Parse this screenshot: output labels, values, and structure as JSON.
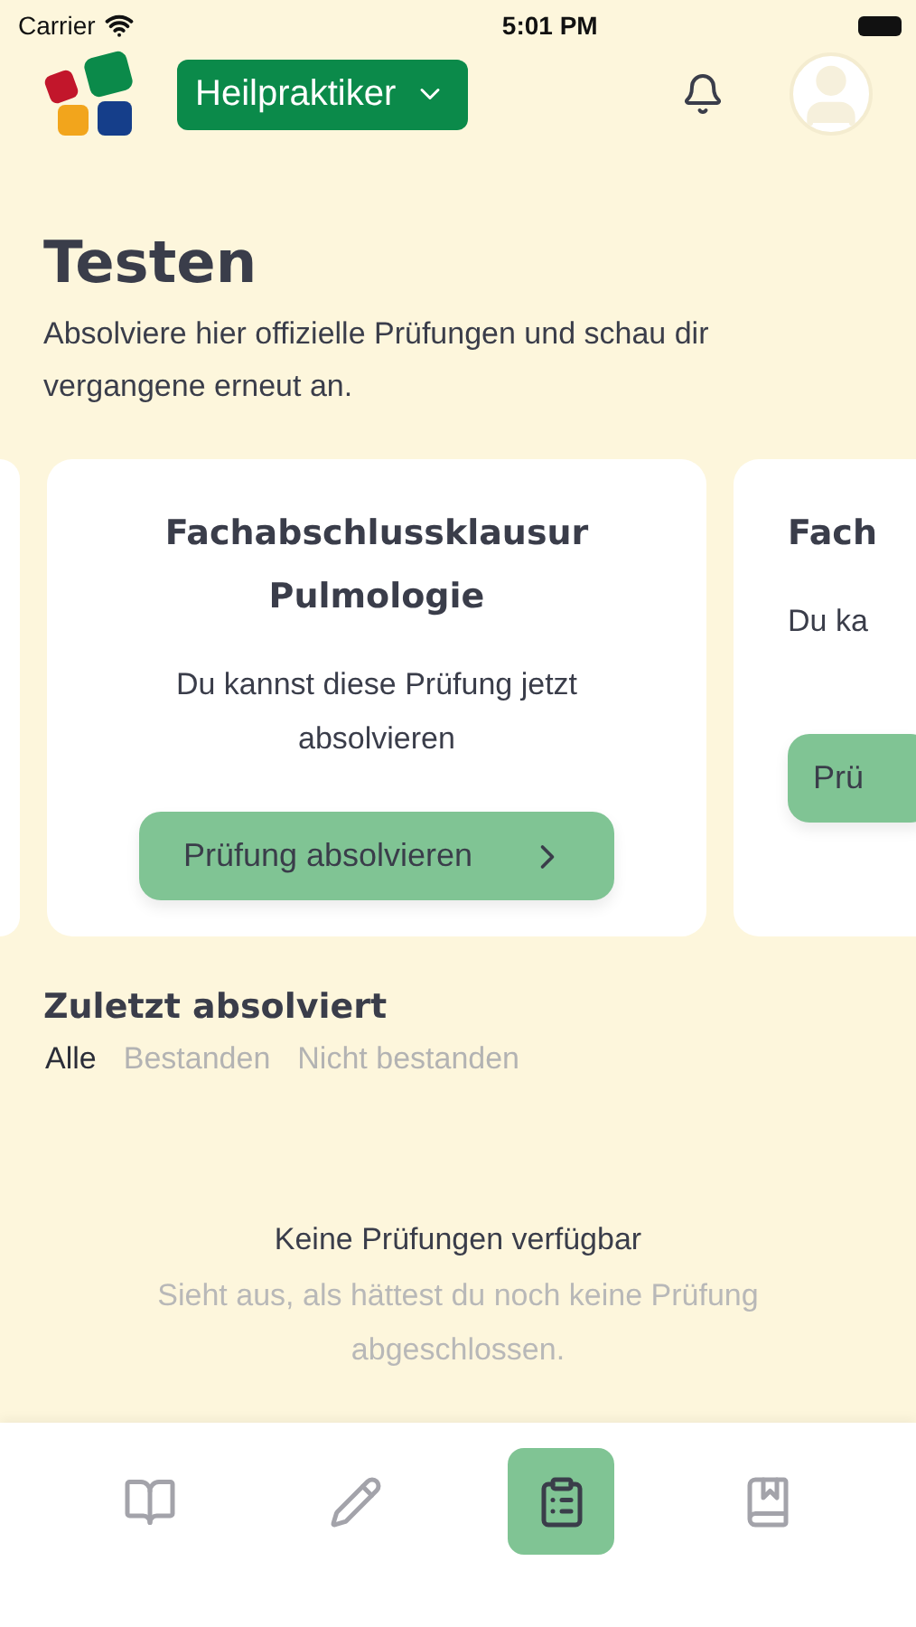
{
  "status_bar": {
    "carrier": "Carrier",
    "time": "5:01 PM"
  },
  "header": {
    "course": "Heilpraktiker"
  },
  "page": {
    "title": "Testen",
    "subtitle": "Absolviere hier offizielle Prüfungen und schau dir vergangene erneut an."
  },
  "exam_cards": [
    {
      "kind": "sliver"
    },
    {
      "kind": "full",
      "title": "Fachabschlussklausur Pulmologie",
      "description": "Du kannst diese Prüfung jetzt absolvieren",
      "button": "Prüfung absolvieren"
    },
    {
      "kind": "cut",
      "title": "Fach",
      "description": "Du ka",
      "button": "Prü"
    }
  ],
  "recent": {
    "title": "Zuletzt absolviert",
    "filters": [
      {
        "label": "Alle",
        "selected": true
      },
      {
        "label": "Bestanden",
        "selected": false
      },
      {
        "label": "Nicht bestanden",
        "selected": false
      }
    ],
    "empty_title": "Keine Prüfungen verfügbar",
    "empty_text": "Sieht aus, als hättest du noch keine Prüfung abgeschlossen."
  },
  "tab_bar": [
    {
      "kind": "book",
      "selected": false
    },
    {
      "kind": "pencil",
      "selected": false
    },
    {
      "kind": "clipboard",
      "selected": true
    },
    {
      "kind": "bookmark",
      "selected": false
    }
  ]
}
